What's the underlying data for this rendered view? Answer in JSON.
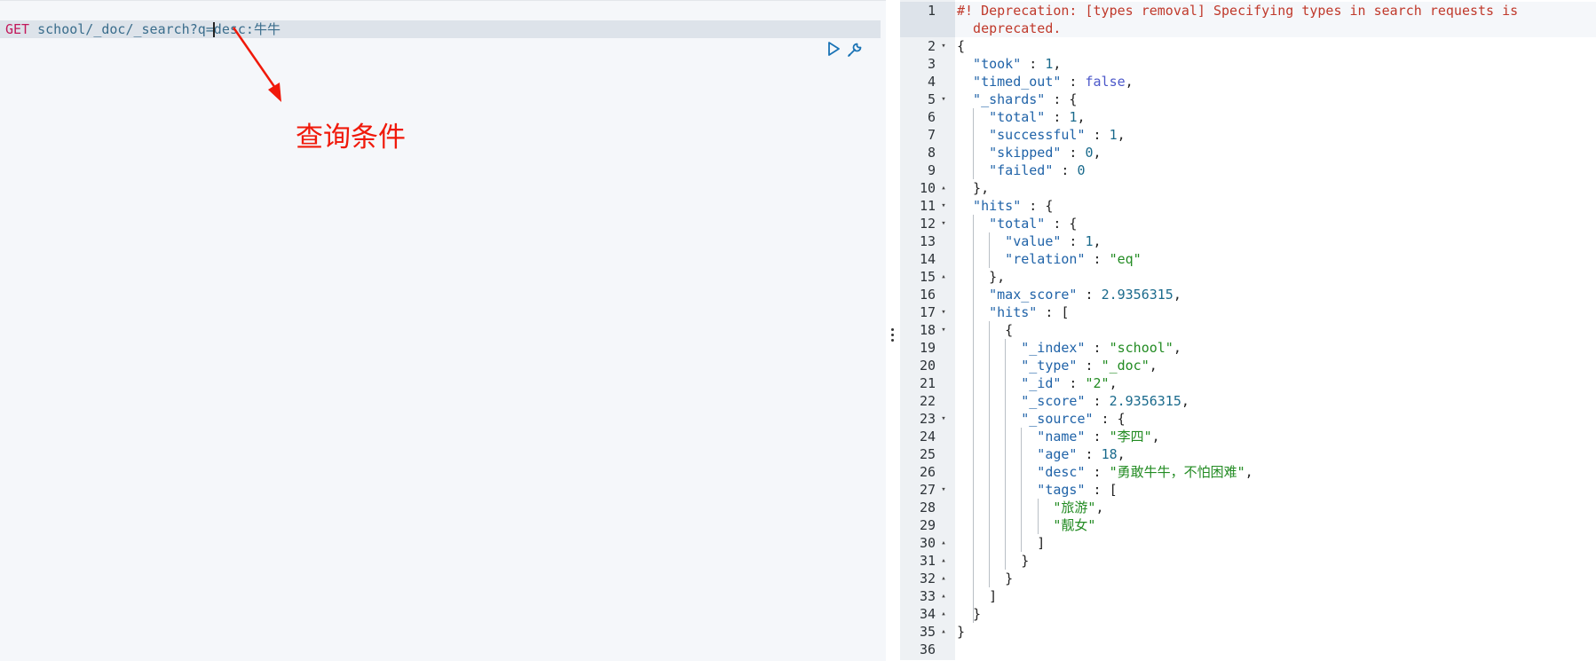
{
  "request": {
    "method": "GET",
    "path": "school/_doc/_search?q=desc:牛牛"
  },
  "annotation": {
    "label": "查询条件"
  },
  "response": {
    "lines": [
      {
        "n": "1",
        "fold": "",
        "segs": [
          [
            "warn",
            "#! Deprecation: [types removal] Specifying types in search requests is"
          ]
        ]
      },
      {
        "n": "",
        "fold": "",
        "segs": [
          [
            "warn",
            "  deprecated."
          ]
        ]
      },
      {
        "n": "2",
        "fold": "▾",
        "segs": [
          [
            "p",
            "{"
          ]
        ]
      },
      {
        "n": "3",
        "fold": "",
        "segs": [
          [
            "k",
            "  \"took\""
          ],
          [
            "p",
            " : "
          ],
          [
            "n",
            "1"
          ],
          [
            "p",
            ","
          ]
        ]
      },
      {
        "n": "4",
        "fold": "",
        "segs": [
          [
            "k",
            "  \"timed_out\""
          ],
          [
            "p",
            " : "
          ],
          [
            "b",
            "false"
          ],
          [
            "p",
            ","
          ]
        ]
      },
      {
        "n": "5",
        "fold": "▾",
        "segs": [
          [
            "k",
            "  \"_shards\""
          ],
          [
            "p",
            " : {"
          ]
        ]
      },
      {
        "n": "6",
        "fold": "",
        "segs": [
          [
            "k",
            "    \"total\""
          ],
          [
            "p",
            " : "
          ],
          [
            "n",
            "1"
          ],
          [
            "p",
            ","
          ]
        ]
      },
      {
        "n": "7",
        "fold": "",
        "segs": [
          [
            "k",
            "    \"successful\""
          ],
          [
            "p",
            " : "
          ],
          [
            "n",
            "1"
          ],
          [
            "p",
            ","
          ]
        ]
      },
      {
        "n": "8",
        "fold": "",
        "segs": [
          [
            "k",
            "    \"skipped\""
          ],
          [
            "p",
            " : "
          ],
          [
            "n",
            "0"
          ],
          [
            "p",
            ","
          ]
        ]
      },
      {
        "n": "9",
        "fold": "",
        "segs": [
          [
            "k",
            "    \"failed\""
          ],
          [
            "p",
            " : "
          ],
          [
            "n",
            "0"
          ]
        ]
      },
      {
        "n": "10",
        "fold": "▴",
        "segs": [
          [
            "p",
            "  },"
          ]
        ]
      },
      {
        "n": "11",
        "fold": "▾",
        "segs": [
          [
            "k",
            "  \"hits\""
          ],
          [
            "p",
            " : {"
          ]
        ]
      },
      {
        "n": "12",
        "fold": "▾",
        "segs": [
          [
            "k",
            "    \"total\""
          ],
          [
            "p",
            " : {"
          ]
        ]
      },
      {
        "n": "13",
        "fold": "",
        "segs": [
          [
            "k",
            "      \"value\""
          ],
          [
            "p",
            " : "
          ],
          [
            "n",
            "1"
          ],
          [
            "p",
            ","
          ]
        ]
      },
      {
        "n": "14",
        "fold": "",
        "segs": [
          [
            "k",
            "      \"relation\""
          ],
          [
            "p",
            " : "
          ],
          [
            "s",
            "\"eq\""
          ]
        ]
      },
      {
        "n": "15",
        "fold": "▴",
        "segs": [
          [
            "p",
            "    },"
          ]
        ]
      },
      {
        "n": "16",
        "fold": "",
        "segs": [
          [
            "k",
            "    \"max_score\""
          ],
          [
            "p",
            " : "
          ],
          [
            "n",
            "2.9356315"
          ],
          [
            "p",
            ","
          ]
        ]
      },
      {
        "n": "17",
        "fold": "▾",
        "segs": [
          [
            "k",
            "    \"hits\""
          ],
          [
            "p",
            " : ["
          ]
        ]
      },
      {
        "n": "18",
        "fold": "▾",
        "segs": [
          [
            "p",
            "      {"
          ]
        ]
      },
      {
        "n": "19",
        "fold": "",
        "segs": [
          [
            "k",
            "        \"_index\""
          ],
          [
            "p",
            " : "
          ],
          [
            "s",
            "\"school\""
          ],
          [
            "p",
            ","
          ]
        ]
      },
      {
        "n": "20",
        "fold": "",
        "segs": [
          [
            "k",
            "        \"_type\""
          ],
          [
            "p",
            " : "
          ],
          [
            "s",
            "\"_doc\""
          ],
          [
            "p",
            ","
          ]
        ]
      },
      {
        "n": "21",
        "fold": "",
        "segs": [
          [
            "k",
            "        \"_id\""
          ],
          [
            "p",
            " : "
          ],
          [
            "s",
            "\"2\""
          ],
          [
            "p",
            ","
          ]
        ]
      },
      {
        "n": "22",
        "fold": "",
        "segs": [
          [
            "k",
            "        \"_score\""
          ],
          [
            "p",
            " : "
          ],
          [
            "n",
            "2.9356315"
          ],
          [
            "p",
            ","
          ]
        ]
      },
      {
        "n": "23",
        "fold": "▾",
        "segs": [
          [
            "k",
            "        \"_source\""
          ],
          [
            "p",
            " : {"
          ]
        ]
      },
      {
        "n": "24",
        "fold": "",
        "segs": [
          [
            "k",
            "          \"name\""
          ],
          [
            "p",
            " : "
          ],
          [
            "s",
            "\"李四\""
          ],
          [
            "p",
            ","
          ]
        ]
      },
      {
        "n": "25",
        "fold": "",
        "segs": [
          [
            "k",
            "          \"age\""
          ],
          [
            "p",
            " : "
          ],
          [
            "n",
            "18"
          ],
          [
            "p",
            ","
          ]
        ]
      },
      {
        "n": "26",
        "fold": "",
        "segs": [
          [
            "k",
            "          \"desc\""
          ],
          [
            "p",
            " : "
          ],
          [
            "s",
            "\"勇敢牛牛，不怕困难\""
          ],
          [
            "p",
            ","
          ]
        ]
      },
      {
        "n": "27",
        "fold": "▾",
        "segs": [
          [
            "k",
            "          \"tags\""
          ],
          [
            "p",
            " : ["
          ]
        ]
      },
      {
        "n": "28",
        "fold": "",
        "segs": [
          [
            "s",
            "            \"旅游\""
          ],
          [
            "p",
            ","
          ]
        ]
      },
      {
        "n": "29",
        "fold": "",
        "segs": [
          [
            "s",
            "            \"靓女\""
          ]
        ]
      },
      {
        "n": "30",
        "fold": "▴",
        "segs": [
          [
            "p",
            "          ]"
          ]
        ]
      },
      {
        "n": "31",
        "fold": "▴",
        "segs": [
          [
            "p",
            "        }"
          ]
        ]
      },
      {
        "n": "32",
        "fold": "▴",
        "segs": [
          [
            "p",
            "      }"
          ]
        ]
      },
      {
        "n": "33",
        "fold": "▴",
        "segs": [
          [
            "p",
            "    ]"
          ]
        ]
      },
      {
        "n": "34",
        "fold": "▴",
        "segs": [
          [
            "p",
            "  }"
          ]
        ]
      },
      {
        "n": "35",
        "fold": "▴",
        "segs": [
          [
            "p",
            "}"
          ]
        ]
      },
      {
        "n": "36",
        "fold": "",
        "segs": []
      }
    ]
  }
}
